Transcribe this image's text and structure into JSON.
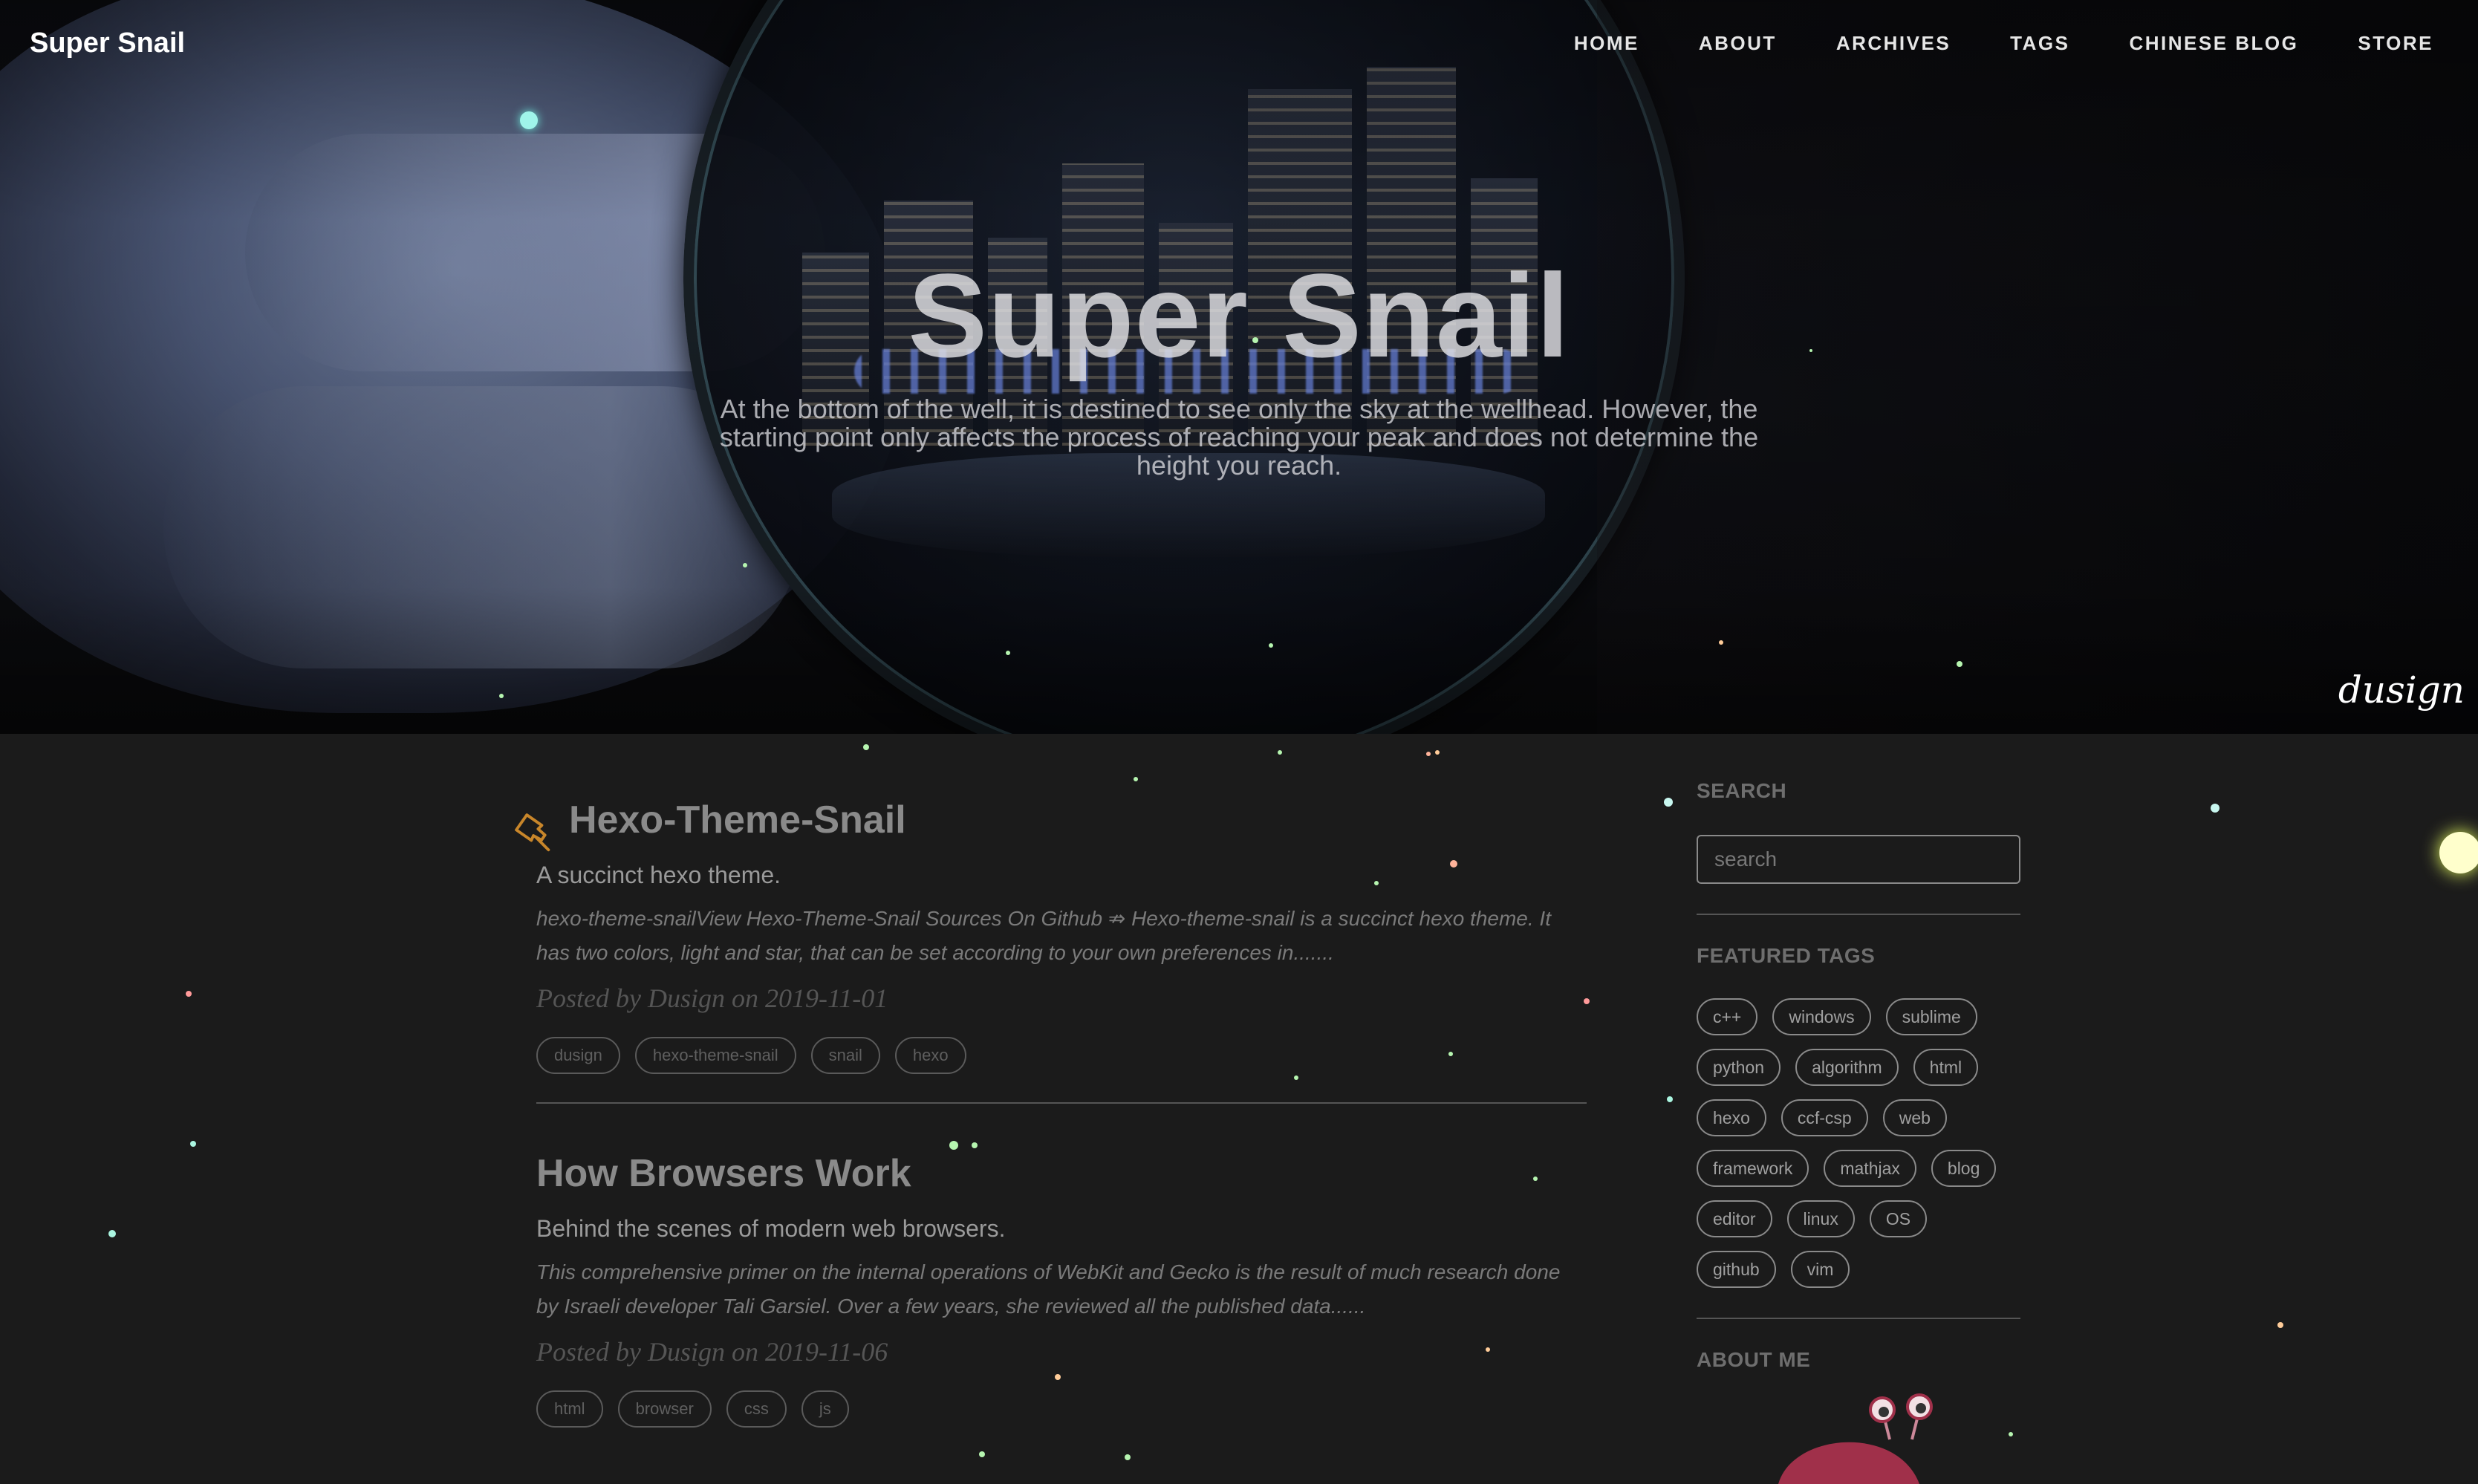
{
  "nav": {
    "brand": "Super Snail",
    "items": [
      {
        "label": "HOME"
      },
      {
        "label": "ABOUT"
      },
      {
        "label": "ARCHIVES"
      },
      {
        "label": "TAGS"
      },
      {
        "label": "CHINESE BLOG"
      },
      {
        "label": "STORE"
      }
    ]
  },
  "hero": {
    "title": "Super Snail",
    "subtitle": "At the bottom of the well, it is destined to see only the sky at the wellhead. However, the starting point only affects the process of reaching your peak and does not determine the height you reach.",
    "signature": "dusign"
  },
  "posts": [
    {
      "title": "Hexo-Theme-Snail",
      "pinned": true,
      "subtitle": "A succinct hexo theme.",
      "excerpt": "hexo-theme-snailView Hexo-Theme-Snail Sources On Github ⇏ Hexo-theme-snail is a succinct hexo theme. It has two colors, light and star, that can be set according to your own preferences in.......",
      "meta": "Posted by Dusign on 2019-11-01",
      "tags": [
        "dusign",
        "hexo-theme-snail",
        "snail",
        "hexo"
      ]
    },
    {
      "title": "How Browsers Work",
      "pinned": false,
      "subtitle": "Behind the scenes of modern web browsers.",
      "excerpt": "This comprehensive primer on the internal operations of WebKit and Gecko is the result of much research done by Israeli developer Tali Garsiel. Over a few years, she reviewed all the published data......",
      "meta": "Posted by Dusign on 2019-11-06",
      "tags": [
        "html",
        "browser",
        "css",
        "js"
      ]
    }
  ],
  "sidebar": {
    "search_heading": "SEARCH",
    "search_placeholder": "search",
    "featured_heading": "FEATURED TAGS",
    "featured_tags": [
      "c++",
      "windows",
      "sublime",
      "python",
      "algorithm",
      "html",
      "hexo",
      "ccf-csp",
      "web",
      "framework",
      "mathjax",
      "blog",
      "editor",
      "linux",
      "OS",
      "github",
      "vim"
    ],
    "about_heading": "ABOUT ME"
  },
  "colors": {
    "background": "#1b1b1b",
    "pin_accent": "#c8862a",
    "snail_body": "#a0304a"
  },
  "icons": {
    "pin": "pushpin-icon",
    "avatar": "snail-avatar"
  }
}
